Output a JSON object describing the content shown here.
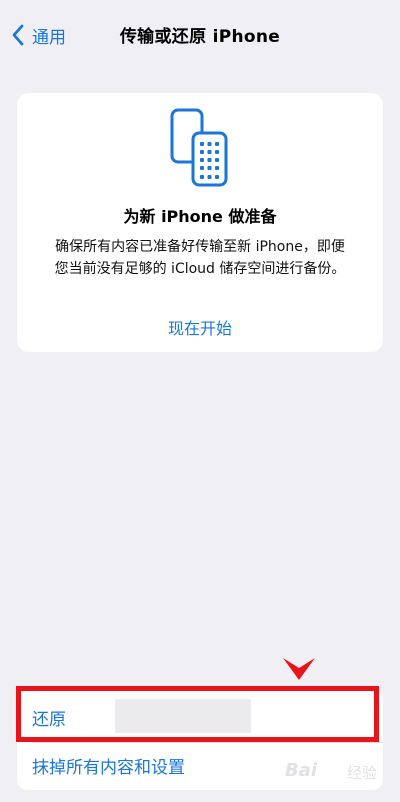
{
  "nav": {
    "back_label": "通用",
    "title": "传输或还原 iPhone"
  },
  "card": {
    "icon": "phones-transfer-icon",
    "title": "为新 iPhone 做准备",
    "desc_line1": "确保所有内容已准备好传输至新 iPhone，即便",
    "desc_line2": "您当前没有足够的 iCloud 储存空间进行备份。",
    "action_label": "现在开始"
  },
  "list": {
    "restore_label": "还原",
    "erase_label": "抹掉所有内容和设置"
  },
  "watermark": {
    "brand": "Bai",
    "suffix": "经验"
  },
  "colors": {
    "accent": "#1a76d8",
    "background": "#efeff4",
    "card": "#ffffff",
    "annotation": "#e8141b"
  }
}
